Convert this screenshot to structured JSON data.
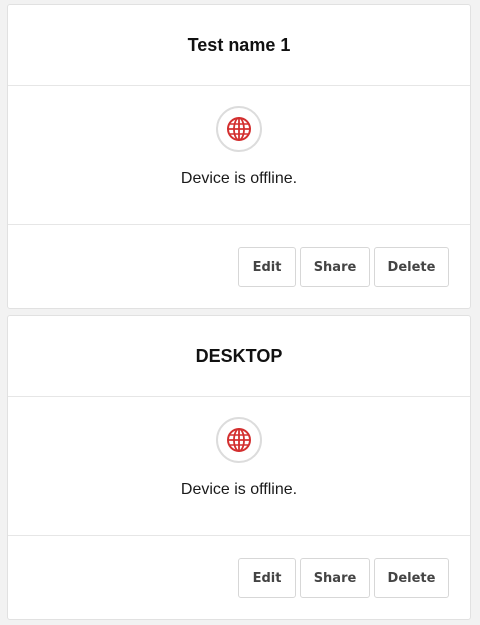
{
  "devices": [
    {
      "title": "Test name 1",
      "status": "Device is offline.",
      "buttons": {
        "edit": "Edit",
        "share": "Share",
        "delete": "Delete"
      }
    },
    {
      "title": "DESKTOP",
      "status": "Device is offline.",
      "buttons": {
        "edit": "Edit",
        "share": "Share",
        "delete": "Delete"
      }
    }
  ],
  "icons": {
    "status": "globe-icon"
  },
  "colors": {
    "globe": "#d32f2f",
    "page_background": "#f2f2f2"
  }
}
